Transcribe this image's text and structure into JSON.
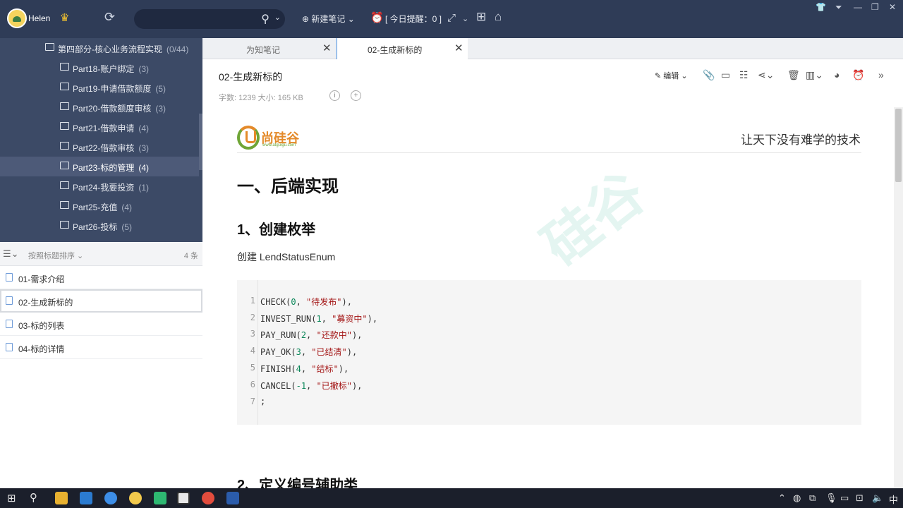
{
  "topbar": {
    "username": "Helen",
    "new_note": "⊕ 新建笔记 ⌄",
    "reminder": "[ 今日提醒：0 ]",
    "colors": {
      "bg": "#2f3c57",
      "search_bg": "#1f2940"
    }
  },
  "notebooks": [
    {
      "label": "第四部分-核心业务流程实现",
      "count": "(0/44)"
    },
    {
      "label": "Part18-账户绑定",
      "count": "(3)"
    },
    {
      "label": "Part19-申请借款额度",
      "count": "(5)"
    },
    {
      "label": "Part20-借款额度审核",
      "count": "(3)"
    },
    {
      "label": "Part21-借款申请",
      "count": "(4)"
    },
    {
      "label": "Part22-借款审核",
      "count": "(3)"
    },
    {
      "label": "Part23-标的管理",
      "count": "(4)"
    },
    {
      "label": "Part24-我要投资",
      "count": "(1)"
    },
    {
      "label": "Part25-充值",
      "count": "(4)"
    },
    {
      "label": "Part26-投标",
      "count": "(5)"
    }
  ],
  "sort": {
    "label": "按照标题排序",
    "count": "4 条"
  },
  "notes": [
    {
      "label": "01-需求介绍"
    },
    {
      "label": "02-生成新标的"
    },
    {
      "label": "03-标的列表"
    },
    {
      "label": "04-标的详情"
    }
  ],
  "tabs": [
    {
      "label": "为知笔记"
    },
    {
      "label": "02-生成新标的"
    }
  ],
  "doc": {
    "title": "02-生成新标的",
    "meta": "字数: 1239    大小: 165 KB",
    "edit_label": "编辑",
    "logo_name": "尚硅谷",
    "logo_url": "www.atguigu.com",
    "slogan": "让天下没有难学的技术",
    "watermark": "硅谷",
    "h1": "一、后端实现",
    "h2": "1、创建枚举",
    "para": "创建 LendStatusEnum",
    "code": [
      {
        "n": "1",
        "name": "CHECK",
        "num": "0",
        "str": "\"待发布\""
      },
      {
        "n": "2",
        "name": "INVEST_RUN",
        "num": "1",
        "str": "\"募资中\""
      },
      {
        "n": "3",
        "name": "PAY_RUN",
        "num": "2",
        "str": "\"还款中\""
      },
      {
        "n": "4",
        "name": "PAY_OK",
        "num": "3",
        "str": "\"已结清\""
      },
      {
        "n": "5",
        "name": "FINISH",
        "num": "4",
        "str": "\"结标\""
      },
      {
        "n": "6",
        "name": "CANCEL",
        "num": "-1",
        "str": "\"已撤标\""
      }
    ],
    "code_end": {
      "n": "7",
      "text": ";"
    },
    "h2_next": "2、定义编号辅助类"
  },
  "taskbar": {
    "ime": "中",
    "app_colors": [
      "#e8b130",
      "#2b7bd0",
      "#3d8ee8",
      "#f2c94c",
      "#2eb872",
      "#e8e8e8",
      "#e24c3d",
      "#2b5cab"
    ]
  }
}
